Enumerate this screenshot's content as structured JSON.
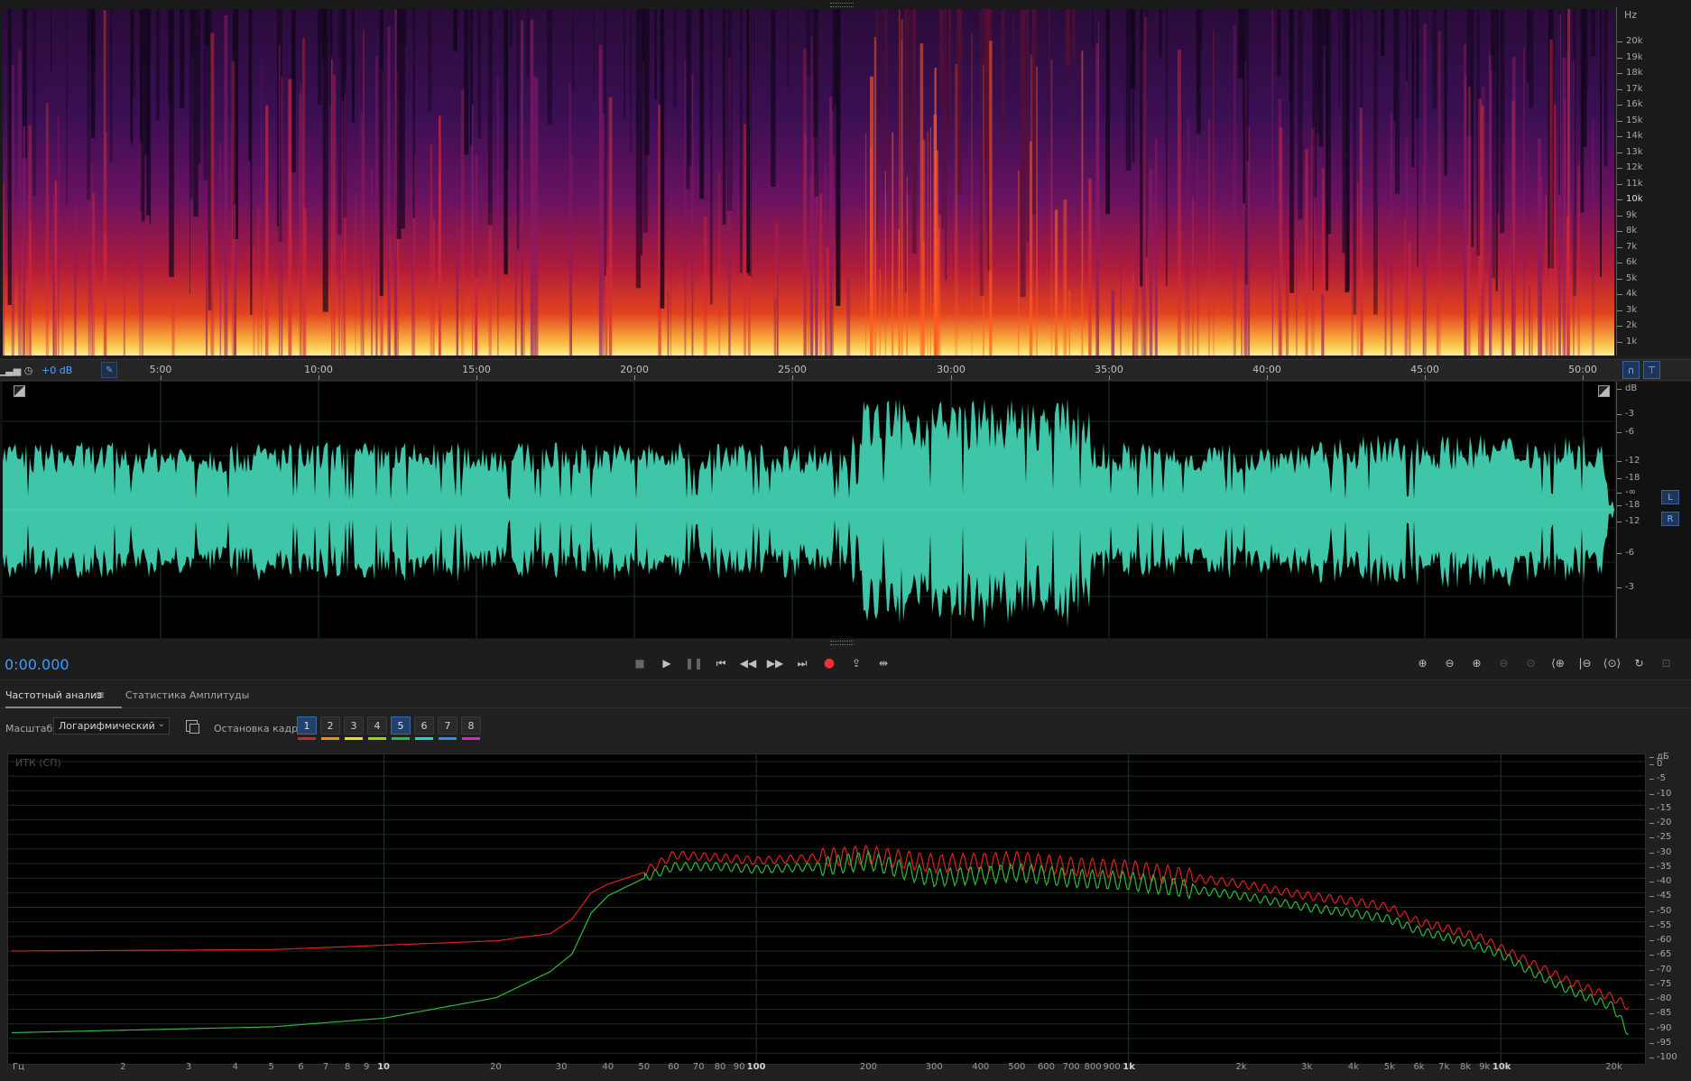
{
  "spectrogram": {
    "unit": "Hz",
    "freq_ticks": [
      "20k",
      "19k",
      "18k",
      "17k",
      "16k",
      "15k",
      "14k",
      "13k",
      "12k",
      "11k",
      "10k",
      "9k",
      "8k",
      "7k",
      "6k",
      "5k",
      "4k",
      "3k",
      "2k",
      "1k"
    ]
  },
  "ruler": {
    "db_readout": "+0 dB",
    "time_ticks": [
      "5:00",
      "10:00",
      "15:00",
      "20:00",
      "25:00",
      "30:00",
      "35:00",
      "40:00",
      "45:00",
      "50:00"
    ]
  },
  "waveform": {
    "db_ticks": [
      "dB",
      "-3",
      "-6",
      "-12",
      "-18",
      "-∞",
      "-18",
      "-12",
      "-6",
      "-3"
    ],
    "channels": [
      "L",
      "R"
    ],
    "color": "#3fc6a8"
  },
  "transport": {
    "timecode": "0:00.000"
  },
  "panel": {
    "tabs": [
      "Частотный анализ",
      "Статистика Амплитуды"
    ],
    "scale_label": "Масштаб:",
    "scale_value": "Логарифмический",
    "frame_hold_label": "Остановка кадра:",
    "frames": [
      {
        "label": "1",
        "color": "#e02020",
        "on": true
      },
      {
        "label": "2",
        "color": "#ff8a00",
        "on": false
      },
      {
        "label": "3",
        "color": "#f3e000",
        "on": false
      },
      {
        "label": "4",
        "color": "#8ee000",
        "on": false
      },
      {
        "label": "5",
        "color": "#20c040",
        "on": true
      },
      {
        "label": "6",
        "color": "#20d0e0",
        "on": false
      },
      {
        "label": "7",
        "color": "#2090ff",
        "on": false
      },
      {
        "label": "8",
        "color": "#e020d0",
        "on": false
      }
    ],
    "analyzer_label": "ИТК (СП)",
    "db_ticks": [
      "дБ",
      "0",
      "-5",
      "-10",
      "-15",
      "-20",
      "-25",
      "-30",
      "-35",
      "-40",
      "-45",
      "-50",
      "-55",
      "-60",
      "-65",
      "-70",
      "-75",
      "-80",
      "-85",
      "-90",
      "-95",
      "-100"
    ],
    "freq_labels": [
      {
        "t": "Гц",
        "f": null
      },
      {
        "t": "2",
        "f": 2
      },
      {
        "t": "3",
        "f": 3
      },
      {
        "t": "4",
        "f": 4
      },
      {
        "t": "5",
        "f": 5
      },
      {
        "t": "6",
        "f": 6
      },
      {
        "t": "7",
        "f": 7
      },
      {
        "t": "8",
        "f": 8
      },
      {
        "t": "9",
        "f": 9
      },
      {
        "t": "10",
        "f": 10
      },
      {
        "t": "20",
        "f": 20
      },
      {
        "t": "30",
        "f": 30
      },
      {
        "t": "40",
        "f": 40
      },
      {
        "t": "50",
        "f": 50
      },
      {
        "t": "60",
        "f": 60
      },
      {
        "t": "70",
        "f": 70
      },
      {
        "t": "80",
        "f": 80
      },
      {
        "t": "90",
        "f": 90
      },
      {
        "t": "100",
        "f": 100
      },
      {
        "t": "200",
        "f": 200
      },
      {
        "t": "300",
        "f": 300
      },
      {
        "t": "400",
        "f": 400
      },
      {
        "t": "500",
        "f": 500
      },
      {
        "t": "600",
        "f": 600
      },
      {
        "t": "700",
        "f": 700
      },
      {
        "t": "800",
        "f": 800
      },
      {
        "t": "900",
        "f": 900
      },
      {
        "t": "1k",
        "f": 1000
      },
      {
        "t": "2k",
        "f": 2000
      },
      {
        "t": "3k",
        "f": 3000
      },
      {
        "t": "4k",
        "f": 4000
      },
      {
        "t": "5k",
        "f": 5000
      },
      {
        "t": "6k",
        "f": 6000
      },
      {
        "t": "7k",
        "f": 7000
      },
      {
        "t": "8k",
        "f": 8000
      },
      {
        "t": "9k",
        "f": 9000
      },
      {
        "t": "10k",
        "f": 10000
      },
      {
        "t": "20k",
        "f": 20000
      }
    ]
  },
  "chart_data": {
    "type": "line",
    "x_scale": "log",
    "xlim": [
      1,
      22050
    ],
    "ylim": [
      -100,
      0
    ],
    "x": [
      1,
      5,
      10,
      20,
      28,
      32,
      36,
      40,
      50,
      60,
      80,
      100,
      150,
      200,
      300,
      500,
      700,
      1000,
      1500,
      2000,
      3000,
      4000,
      5000,
      6000,
      7000,
      8000,
      9000,
      10000,
      12000,
      15000,
      18000,
      20000,
      22000
    ],
    "series": [
      {
        "values": [
          -65,
          -64.5,
          -63,
          -61.5,
          -59,
          -54,
          -45,
          -42,
          -38,
          -32,
          -33,
          -34,
          -33,
          -32,
          -35,
          -34,
          -36,
          -37,
          -40,
          -42,
          -46,
          -48,
          -50,
          -55,
          -57,
          -59,
          -61,
          -64,
          -69,
          -75,
          -79,
          -81,
          -84
        ]
      },
      {
        "values": [
          -93,
          -91,
          -88,
          -81,
          -72,
          -66,
          -52,
          -46,
          -40,
          -36,
          -36,
          -37,
          -36,
          -34,
          -40,
          -38,
          -40,
          -41,
          -44,
          -46,
          -50,
          -52,
          -54,
          -58,
          -60,
          -62,
          -64,
          -66,
          -72,
          -78,
          -82,
          -84,
          -93
        ]
      }
    ]
  }
}
